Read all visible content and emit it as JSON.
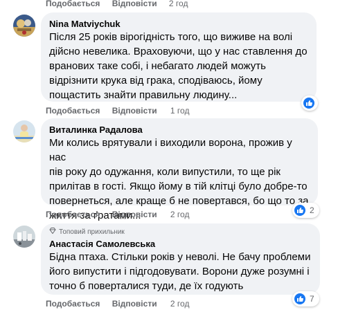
{
  "top": {
    "like": "Подобається",
    "reply": "Відповісти",
    "time": "2 год"
  },
  "comments": [
    {
      "author": "Nina Matviychuk",
      "badge": "",
      "lines": [
        "Після 25 років вірогідність того, що виживе на волі",
        "дійсно невелика. Враховуючи, що у нас ставлення до",
        "вранових таке собі, і небагато людей можуть",
        "відрізнити крука від грака, сподіваюсь, йому",
        "пощастить знайти правильну людину..."
      ],
      "like": "Подобається",
      "reply": "Відповісти",
      "time": "1 год",
      "reaction_count": ""
    },
    {
      "author": "Виталинка Радалова",
      "badge": "",
      "lines": [
        "Ми колись врятували і виходили ворона, прожив у нас",
        "пів року до одужання, коли випустили, то ще рік",
        "прилітав в гості. Якщо йому в тій клітці було добре-то",
        "повернеться, але краще б не повертався, бо що то за",
        "життя за ґратами..."
      ],
      "like": "Подобається",
      "reply": "Відповісти",
      "time": "2 год",
      "reaction_count": "2"
    },
    {
      "author": "Анастасія Самолевська",
      "badge": "Топовий прихильник",
      "lines": [
        "Бідна птаха. Стільки років у неволі. Не бачу проблеми",
        "його випустити і підгодовувати. Ворони дуже розумні і",
        "точно б поверталися туди, де їх годують"
      ],
      "like": "Подобається",
      "reply": "Відповісти",
      "time": "2 год",
      "reaction_count": "7"
    }
  ],
  "colors": {
    "bubble": "#f0f2f5",
    "muted": "#65676b",
    "like": "#1877f2"
  }
}
